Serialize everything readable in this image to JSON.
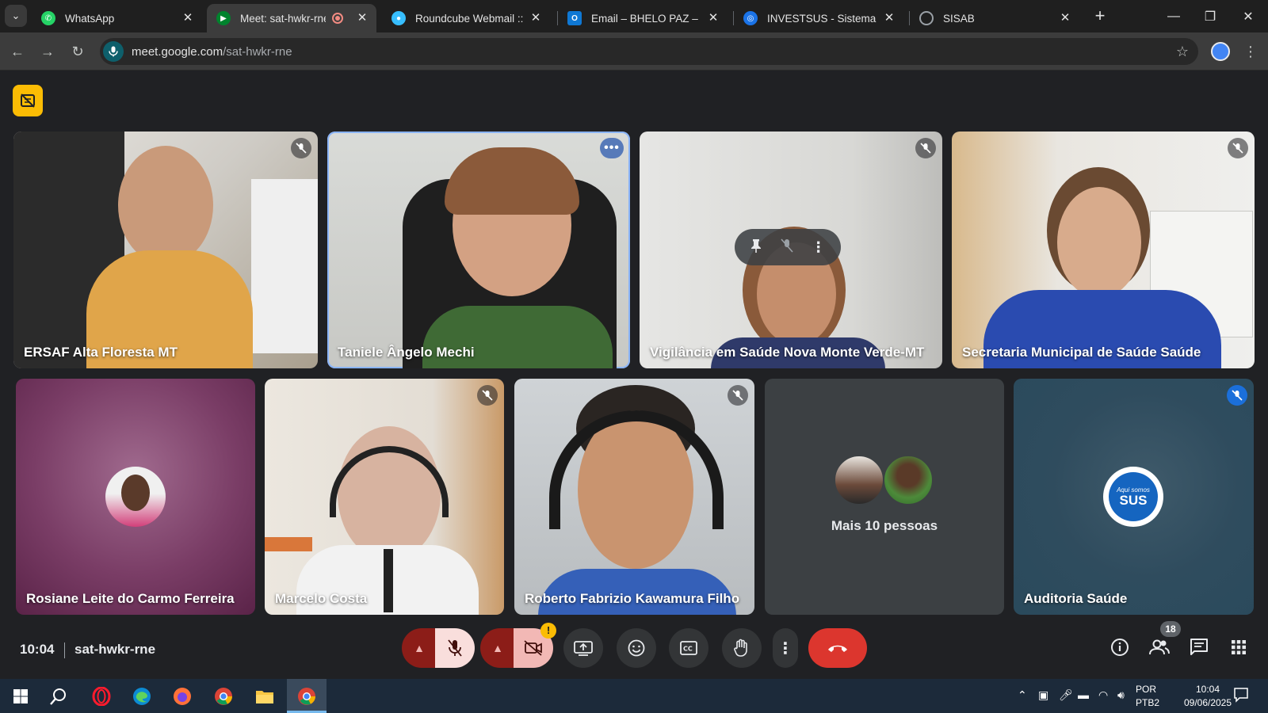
{
  "browser": {
    "tabs": [
      {
        "title": "WhatsApp",
        "icon": "whatsapp-icon",
        "color": "#25d366"
      },
      {
        "title": "Meet: sat-hwkr-rne",
        "icon": "google-meet-icon",
        "color": "#00832d",
        "active": true
      },
      {
        "title": "Roundcube Webmail :: Cai",
        "icon": "roundcube-icon",
        "color": "#37beff"
      },
      {
        "title": "Email – BHELO PAZ – Outlo",
        "icon": "outlook-icon",
        "color": "#0f78d4"
      },
      {
        "title": "INVESTSUS - Sistema de In",
        "icon": "investsus-icon",
        "color": "#1a73e8"
      },
      {
        "title": "SISAB",
        "icon": "globe-icon",
        "color": "#9aa0a6"
      }
    ],
    "url_host": "meet.google.com",
    "url_path": "/sat-hwkr-rne"
  },
  "meeting": {
    "participants_row1": [
      {
        "name": "ERSAF Alta Floresta MT",
        "muted": true
      },
      {
        "name": "Taniele Ângelo Mechi",
        "speaking": true
      },
      {
        "name": "Vigilância em Saúde Nova Monte Verde-MT",
        "muted": true
      },
      {
        "name": "Secretaria Municipal de Saúde Saúde",
        "muted": true
      }
    ],
    "participants_row2": [
      {
        "name": "Rosiane Leite do Carmo Ferreira"
      },
      {
        "name": "Marcelo Costa",
        "muted": true
      },
      {
        "name": "Roberto Fabrizio Kawamura Filho",
        "muted": true
      },
      {
        "name": "Mais 10 pessoas"
      },
      {
        "name": "Auditoria Saúde",
        "muted": true
      }
    ],
    "sus_logo_top": "Aqui somos",
    "sus_logo_bottom": "SUS",
    "time": "10:04",
    "code": "sat-hwkr-rne",
    "people_count": "18",
    "accent": "#8ab4f8",
    "leave_color": "#dc362e"
  },
  "taskbar": {
    "lang_top": "POR",
    "lang_bottom": "PTB2",
    "time": "10:04",
    "date": "09/06/2025"
  }
}
